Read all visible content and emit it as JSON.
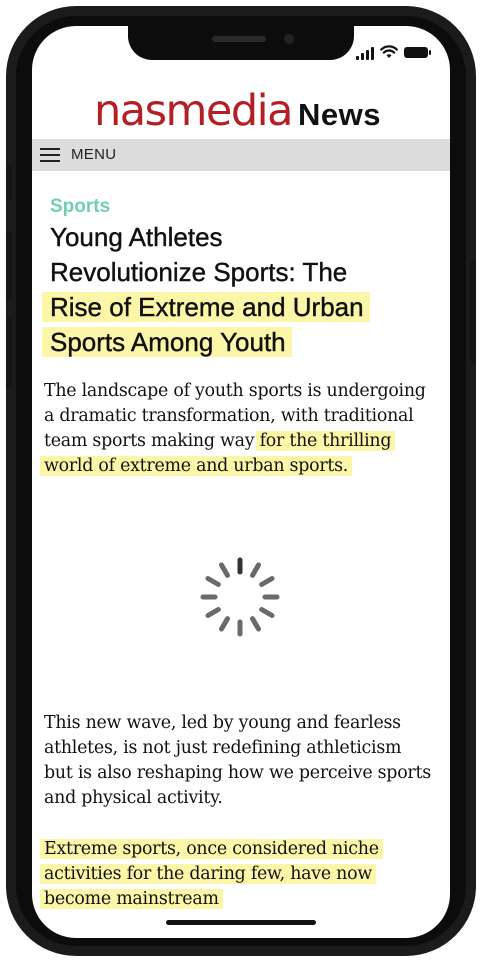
{
  "header": {
    "brand": "nasmedia",
    "section_name": "News"
  },
  "menu": {
    "label": "MENU",
    "icon": "hamburger-icon"
  },
  "status_bar": {
    "icons": [
      "signal-icon",
      "wifi-icon",
      "battery-icon"
    ]
  },
  "article": {
    "category": "Sports",
    "headline_lines": [
      "Young Athletes",
      "Revolutionize Sports: The",
      "Rise of Extreme and Urban",
      "Sports Among Youth"
    ],
    "paragraph1_lines": [
      "The landscape of youth sports is undergoing",
      "a dramatic transformation, with traditional",
      "team sports making way ",
      "for the thrilling",
      "world of extreme and urban sports."
    ],
    "paragraph2_lines": [
      "This new wave, led by young and fearless",
      "athletes, is not just redefining athleticism",
      "but is also reshaping how we perceive sports",
      "and physical activity."
    ],
    "paragraph3_lines": [
      "Extreme sports, once considered niche",
      "activities for the daring few, have now",
      "become mainstream"
    ]
  },
  "loading": {
    "icon": "loading-spinner-icon"
  },
  "colors": {
    "brand_red": "#b41f24",
    "category_teal": "#6fcfb6",
    "highlight_yellow": "#fbf6a8",
    "menu_bar_gray": "#dcdcdc"
  }
}
